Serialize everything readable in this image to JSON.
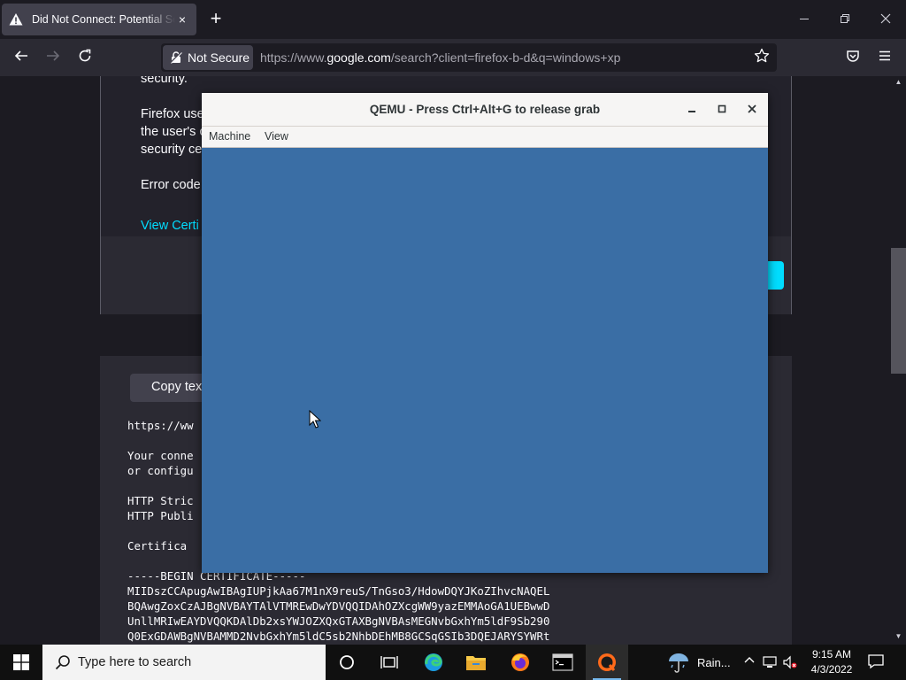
{
  "browser": {
    "tab_title": "Did Not Connect: Potential Security Issue",
    "tab_close": "×",
    "new_tab": "+",
    "security_label": "Not Secure",
    "url_prefix": "https://www.",
    "url_host": "google.com",
    "url_rest": "/search?client=firefox-b-d&q=windows+xp"
  },
  "error_page": {
    "line_security": "security.",
    "line_firefox": "Firefox use",
    "line_users": "the user's c",
    "line_securityce": "security ce",
    "line_errorcode": "Error code",
    "view_certificate": "View Certi",
    "copy_text": "Copy tex"
  },
  "tech_text": {
    "l1": "https://ww",
    "l2": "Your conne",
    "l3": "or configu",
    "l4": "HTTP Stric",
    "l5": "HTTP Publi",
    "l6": "Certifica",
    "l7": "-----BEGIN CERTIFICATE-----",
    "l8": "MIIDszCCApugAwIBAgIUPjkAa67M1nX9reuS/TnGso3/HdowDQYJKoZIhvcNAQEL",
    "l9": "BQAwgZoxCzAJBgNVBAYTAlVTMREwDwYDVQQIDAhOZXcgWW9yazEMMAoGA1UEBwwD",
    "l10": "UnllMRIwEAYDVQQKDAlDb2xsYWJOZXQxGTAXBgNVBAsMEGNvbGxhYm5ldF9Sb290",
    "l11": "Q0ExGDAWBgNVBAMMD2NvbGxhYm5ldC5sb2NhbDEhMB8GCSqGSIb3DQEJARYSYWRt"
  },
  "qemu": {
    "title": "QEMU - Press Ctrl+Alt+G to release grab",
    "menu_machine": "Machine",
    "menu_view": "View",
    "screen_color": "#3a6ea5"
  },
  "taskbar": {
    "search_placeholder": "Type here to search",
    "weather": "Rain...",
    "time": "9:15 AM",
    "date": "4/3/2022"
  }
}
